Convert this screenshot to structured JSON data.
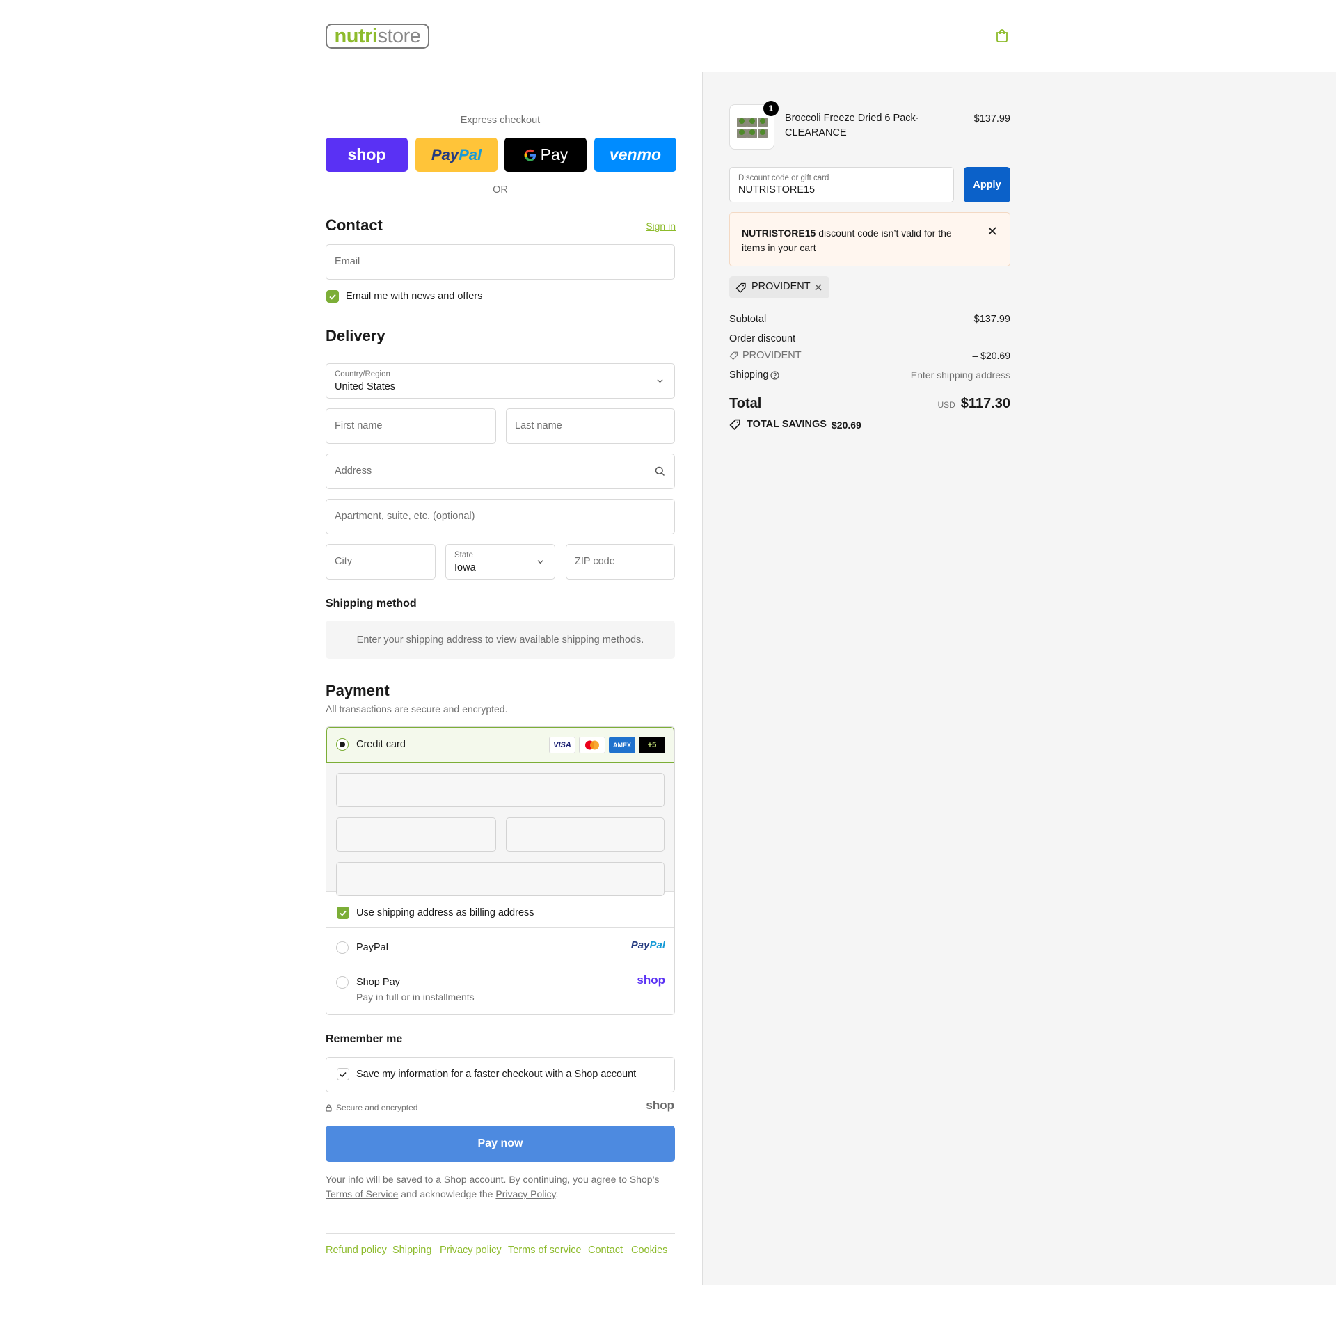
{
  "header": {
    "logo_green": "nutri",
    "logo_gray": "store"
  },
  "express": {
    "title": "Express checkout",
    "shop_label": "shop",
    "paypal_label_1": "Pay",
    "paypal_label_2": "Pal",
    "gpay_label": "Pay",
    "venmo_label": "venmo",
    "or_label": "OR"
  },
  "contact": {
    "title": "Contact",
    "sign_in": "Sign in",
    "email_placeholder": "Email",
    "news_label": "Email me with news and offers"
  },
  "delivery": {
    "title": "Delivery",
    "country_label": "Country/Region",
    "country_value": "United States",
    "first_name": "First name",
    "last_name": "Last name",
    "address": "Address",
    "apartment": "Apartment, suite, etc. (optional)",
    "city": "City",
    "state_label": "State",
    "state_value": "Iowa",
    "zip": "ZIP code"
  },
  "shipping_method": {
    "title": "Shipping method",
    "message": "Enter your shipping address to view available shipping methods."
  },
  "payment": {
    "title": "Payment",
    "subtitle": "All transactions are secure and encrypted.",
    "credit_card": "Credit card",
    "cards": [
      "VISA",
      "",
      "AMEX",
      "+5"
    ],
    "billing_label": "Use shipping address as billing address",
    "paypal": "PayPal",
    "paypal_logo_1": "Pay",
    "paypal_logo_2": "Pal",
    "shop_pay": "Shop Pay",
    "shop_pay_sub": "Pay in full or in installments",
    "shop_logo": "shop"
  },
  "remember": {
    "title": "Remember me",
    "save_label": "Save my information for a faster checkout with a Shop account",
    "secure": "Secure and encrypted",
    "shop_logo": "shop"
  },
  "pay_now": "Pay now",
  "legal": {
    "line1": "Your info will be saved to a Shop account. By continuing, you agree to Shop’s",
    "terms": "Terms of Service",
    "mid": " and acknowledge the ",
    "privacy": "Privacy Policy",
    "end": "."
  },
  "footer_links": [
    "Refund policy",
    "Shipping",
    "Privacy policy",
    "Terms of service",
    "Contact",
    "Cookies"
  ],
  "summary": {
    "item_qty": "1",
    "item_name_1": "Broccoli Freeze Dried 6 Pack-",
    "item_name_2": "CLEARANCE",
    "item_price": "$137.99",
    "discount_label": "Discount code or gift card",
    "discount_value": "NUTRISTORE15",
    "apply": "Apply",
    "error_code": "NUTRISTORE15",
    "error_msg_1": " discount code isn’t valid for the",
    "error_msg_2": "items in your cart",
    "tag_code": "PROVIDENT",
    "subtotal_label": "Subtotal",
    "subtotal_value": "$137.99",
    "order_discount_label": "Order discount",
    "discount_code": "PROVIDENT",
    "discount_amount": "– $20.69",
    "shipping_label": "Shipping",
    "shipping_value": "Enter shipping address",
    "total_label": "Total",
    "currency": "USD",
    "total_value": "$117.30",
    "savings_label": "TOTAL SAVINGS",
    "savings_value": "$20.69"
  },
  "colors": {
    "brand_green": "#8dbb2c",
    "shop_purple": "#5a31f4",
    "paypal_yellow": "#ffc439",
    "venmo_blue": "#008cff",
    "apply_blue": "#0b61c9",
    "pay_now_blue": "#4d8ae0"
  }
}
